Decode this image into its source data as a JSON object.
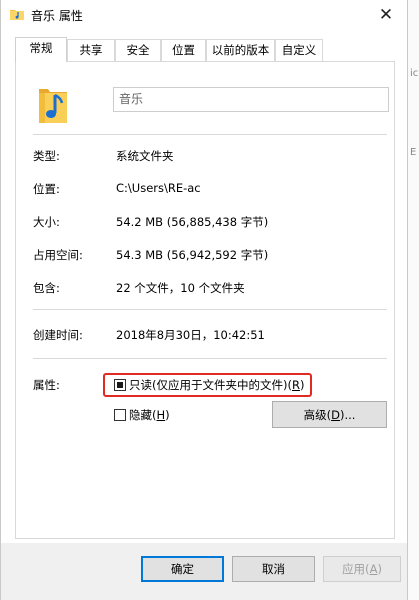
{
  "window": {
    "title": "音乐 属性",
    "close_glyph": "✕"
  },
  "tabs": [
    {
      "label": "常规",
      "active": true
    },
    {
      "label": "共享"
    },
    {
      "label": "安全"
    },
    {
      "label": "位置"
    },
    {
      "label": "以前的版本"
    },
    {
      "label": "自定义"
    }
  ],
  "general": {
    "folder_name": "音乐",
    "rows": [
      {
        "label": "类型:",
        "value": "系统文件夹"
      },
      {
        "label": "位置:",
        "value": "C:\\Users\\RE-ac"
      },
      {
        "label": "大小:",
        "value": "54.2 MB (56,885,438 字节)"
      },
      {
        "label": "占用空间:",
        "value": "54.3 MB (56,942,592 字节)"
      },
      {
        "label": "包含:",
        "value": "22 个文件，10 个文件夹"
      },
      {
        "label": "创建时间:",
        "value": "2018年8月30日，10:42:51"
      }
    ],
    "attributes_label": "属性:",
    "readonly": {
      "label_main": "只读(仅应用于文件夹中的文件)(",
      "key": "R",
      "label_end": ")",
      "state": "indeterminate"
    },
    "hidden": {
      "label_main": "隐藏(",
      "key": "H",
      "label_end": ")",
      "checked": false
    },
    "advanced": {
      "label_main": "高级(",
      "key": "D",
      "label_end": ")..."
    }
  },
  "buttons": {
    "ok": "确定",
    "cancel": "取消",
    "apply_main": "应用(",
    "apply_key": "A",
    "apply_end": ")"
  },
  "colors": {
    "highlight": "#e22a22",
    "primary_border": "#0078d7",
    "folder": "#f5c342",
    "note": "#1b6fd1"
  },
  "background_window": {
    "fragments": [
      "ic",
      "E"
    ]
  }
}
